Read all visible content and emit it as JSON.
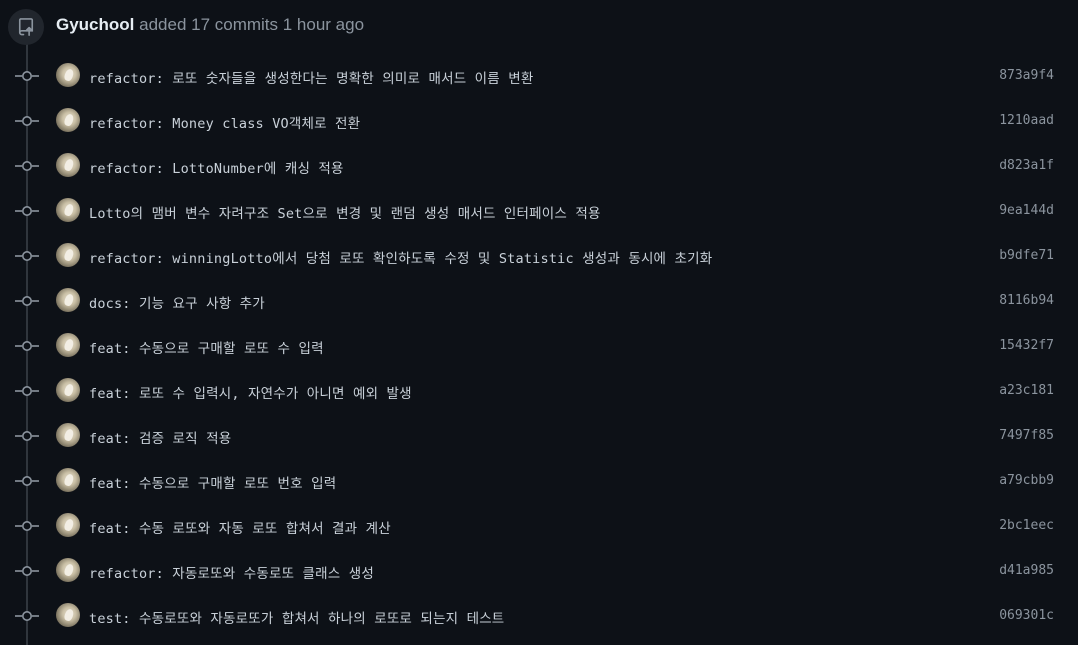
{
  "header": {
    "author": "Gyuchool",
    "action_text": " added 17 commits 1 hour ago",
    "icon": "repo-push-icon"
  },
  "commits": [
    {
      "message": "refactor: 로또 숫자들을 생성한다는 명확한 의미로 매서드 이름 변환",
      "sha": "873a9f4"
    },
    {
      "message": "refactor: Money class VO객체로 전환",
      "sha": "1210aad"
    },
    {
      "message": "refactor: LottoNumber에 캐싱 적용",
      "sha": "d823a1f"
    },
    {
      "message": "Lotto의 맴버 변수 자려구조 Set으로 변경 및 랜덤 생성 매서드 인터페이스 적용",
      "sha": "9ea144d"
    },
    {
      "message": "refactor: winningLotto에서 당첨 로또 확인하도록 수정 및 Statistic 생성과 동시에 초기화",
      "sha": "b9dfe71"
    },
    {
      "message": "docs: 기능 요구 사항 추가",
      "sha": "8116b94"
    },
    {
      "message": "feat: 수동으로 구매할 로또 수 입력",
      "sha": "15432f7"
    },
    {
      "message": "feat: 로또 수 입력시, 자연수가 아니면 예외 발생",
      "sha": "a23c181"
    },
    {
      "message": "feat: 검증 로직 적용",
      "sha": "7497f85"
    },
    {
      "message": "feat: 수동으로 구매할 로또 번호 입력",
      "sha": "a79cbb9"
    },
    {
      "message": "feat: 수동 로또와 자동 로또 합쳐서 결과 계산",
      "sha": "2bc1eec"
    },
    {
      "message": "refactor: 자동로또와 수동로또 클래스 생성",
      "sha": "d41a985"
    },
    {
      "message": "test: 수동로또와 자동로또가 합쳐서 하나의 로또로 되는지 테스트",
      "sha": "069301c"
    }
  ],
  "colors": {
    "background": "#0d1117",
    "timeline": "#30363d",
    "text_primary": "#e6edf3",
    "text_muted": "#8b949e",
    "commit_text": "#c9d1d9"
  }
}
